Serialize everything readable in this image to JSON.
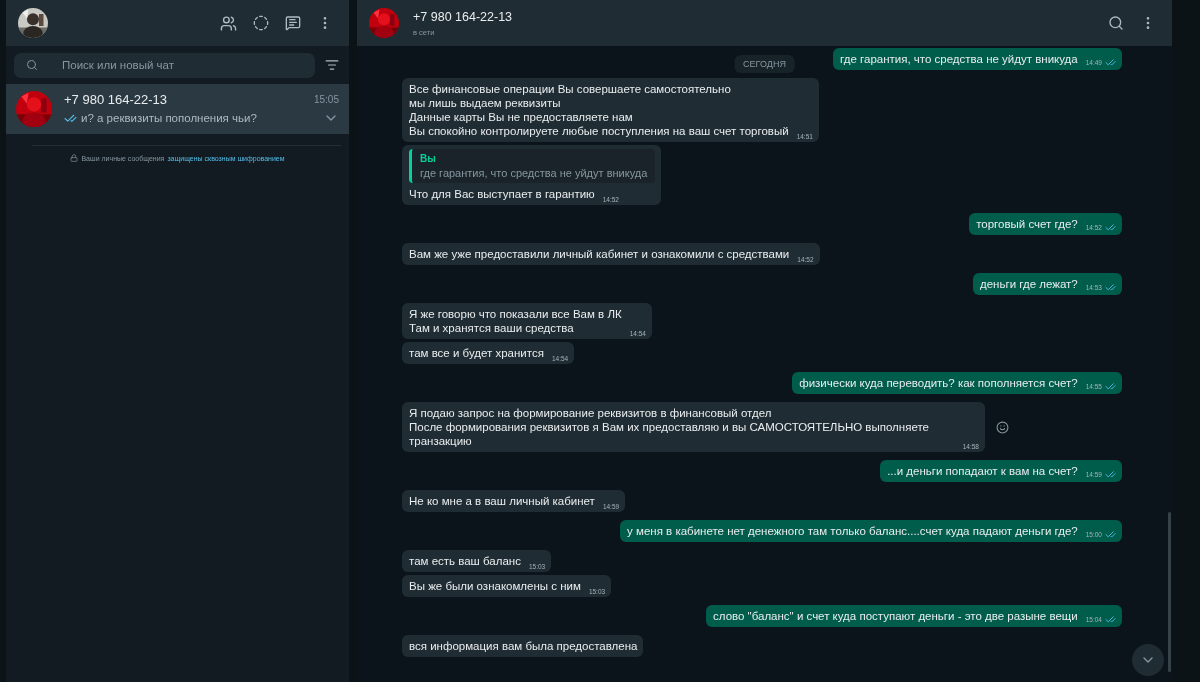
{
  "sidebar": {
    "search": {
      "placeholder": "Поиск или новый чат"
    },
    "chats": [
      {
        "name": "+7 980 164-22-13",
        "time": "15:05",
        "preview": "и? а реквизиты пополнения чьи?",
        "read": true,
        "selected": true
      }
    ],
    "encryption_notice": {
      "text": "Ваши личные сообщения",
      "link": "защищены сквозным шифрованием"
    }
  },
  "chat": {
    "title": "+7 980 164-22-13",
    "status": "в сети",
    "date_chip": "СЕГОДНЯ",
    "messages": [
      {
        "kind": "sent",
        "text": "где гарантия, что средства не уйдут вникуда",
        "time": "14:49",
        "read": true
      },
      {
        "kind": "received",
        "text": "Все финансовые операции Вы совершаете самостоятельно\nмы лишь выдаем реквизиты\nДанные карты Вы не предоставляете нам\nВы спокойно контролируете любые поступления на ваш счет торговый",
        "time": "14:51"
      },
      {
        "kind": "received",
        "quote": {
          "author": "Вы",
          "text": "где гарантия, что средства не уйдут вникуда"
        },
        "text": "Что для Вас выступает в гарантию",
        "time": "14:52"
      },
      {
        "kind": "sent",
        "text": "торговый счет где?",
        "time": "14:52",
        "read": true
      },
      {
        "kind": "received",
        "text": "Вам же уже предоставили личный кабинет и ознакомили с средствами",
        "time": "14:52"
      },
      {
        "kind": "sent",
        "text": "деньги где лежат?",
        "time": "14:53",
        "read": true
      },
      {
        "kind": "received",
        "text": "Я же говорю что показали все Вам в ЛК\nТам и хранятся ваши средства",
        "time": "14:54"
      },
      {
        "kind": "received",
        "text": "там все и будет хранится",
        "time": "14:54"
      },
      {
        "kind": "sent",
        "text": "физически куда переводить? как пополняется счет?",
        "time": "14:55",
        "read": true
      },
      {
        "kind": "received",
        "text": "Я подаю запрос на формирование реквизитов в финансовый отдел\nПосле формирования реквизитов я Вам их предоставляю и вы САМОСТОЯТЕЛЬНО выполняете транзакцию",
        "time": "14:58",
        "reaction_button": true
      },
      {
        "kind": "sent",
        "text": "...и деньги попадают к вам на счет?",
        "time": "14:59",
        "read": true
      },
      {
        "kind": "received",
        "text": "Не ко мне а в ваш личный кабинет",
        "time": "14:59"
      },
      {
        "kind": "sent",
        "text": "у меня в кабинете нет денежного там только баланс....счет куда падают деньги где?",
        "time": "15:00",
        "read": true
      },
      {
        "kind": "received",
        "text": "там есть ваш баланс",
        "time": "15:03"
      },
      {
        "kind": "received",
        "text": "Вы же были ознакомлены с ним",
        "time": "15:03"
      },
      {
        "kind": "sent",
        "text": "слово \"баланс\" и счет куда поступают деньги - это две разыне вещи",
        "time": "15:04",
        "read": true
      },
      {
        "kind": "received",
        "text": "вся информация вам была предоставлена"
      }
    ]
  }
}
